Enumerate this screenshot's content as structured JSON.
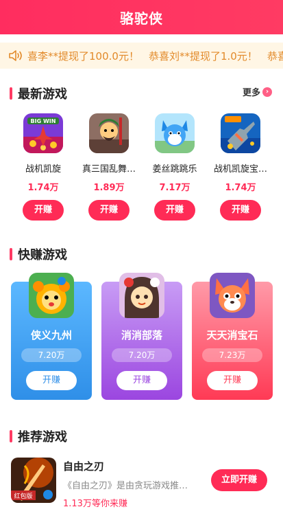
{
  "header": {
    "title": "骆驼侠"
  },
  "ticker": {
    "messages": [
      "喜李**提现了100.0元！",
      "恭喜刘**提现了1.0元！",
      "恭喜"
    ]
  },
  "sections": {
    "newest": {
      "title": "最新游戏",
      "more_label": "更多"
    },
    "quick": {
      "title": "快赚游戏"
    },
    "recommend": {
      "title": "推荐游戏"
    }
  },
  "new_games": [
    {
      "name": "战机凯旋",
      "count": "1.74万",
      "button": "开赚",
      "icon": "fighter-jet-game-icon"
    },
    {
      "name": "真三国乱舞…",
      "count": "1.89万",
      "button": "开赚",
      "icon": "three-kingdoms-warrior-icon"
    },
    {
      "name": "姜丝跳跳乐",
      "count": "7.17万",
      "button": "开赚",
      "icon": "blue-fox-icon"
    },
    {
      "name": "战机凯旋宝…",
      "count": "1.74万",
      "button": "开赚",
      "icon": "fighter-plane-icon"
    }
  ],
  "quick_games": [
    {
      "name": "侠义九州",
      "count": "7.20万",
      "button": "开赚",
      "icon": "lion-cub-icon",
      "color": "#2f9af0"
    },
    {
      "name": "消消部落",
      "count": "7.20万",
      "button": "开赚",
      "icon": "girl-character-icon",
      "color": "#a24fe0"
    },
    {
      "name": "天天消宝石",
      "count": "7.23万",
      "button": "开赚",
      "icon": "fox-character-icon",
      "color": "#ff3a55"
    }
  ],
  "recommended": [
    {
      "name": "自由之刃",
      "desc": "《自由之刃》是由贪玩游戏推…",
      "count": "1.13万等你来赚",
      "button": "立即开赚",
      "badge": "红包版",
      "icon": "blade-warrior-icon"
    }
  ],
  "colors": {
    "accent": "#ff2b56",
    "ticker_text": "#e28a2a",
    "ticker_bg": "#fff6e5"
  }
}
